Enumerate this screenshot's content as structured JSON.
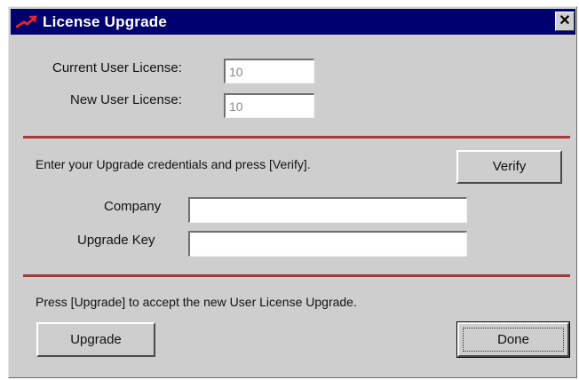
{
  "window": {
    "title": "License Upgrade",
    "close_glyph": "✕",
    "title_bar_color": "#00006e",
    "icon": "license-key-icon"
  },
  "license": {
    "current_label": "Current User License:",
    "current_value": "10",
    "new_label": "New User License:",
    "new_value": "10"
  },
  "credentials": {
    "instruction": "Enter your Upgrade credentials and press [Verify].",
    "verify_label": "Verify",
    "company_label": "Company",
    "company_value": "",
    "key_label": "Upgrade Key",
    "key_value": ""
  },
  "upgrade": {
    "instruction": "Press [Upgrade] to accept the new User License Upgrade.",
    "upgrade_label": "Upgrade",
    "done_label": "Done"
  },
  "colors": {
    "separator": "#a63a3a",
    "dialog_bg": "#cecece"
  }
}
